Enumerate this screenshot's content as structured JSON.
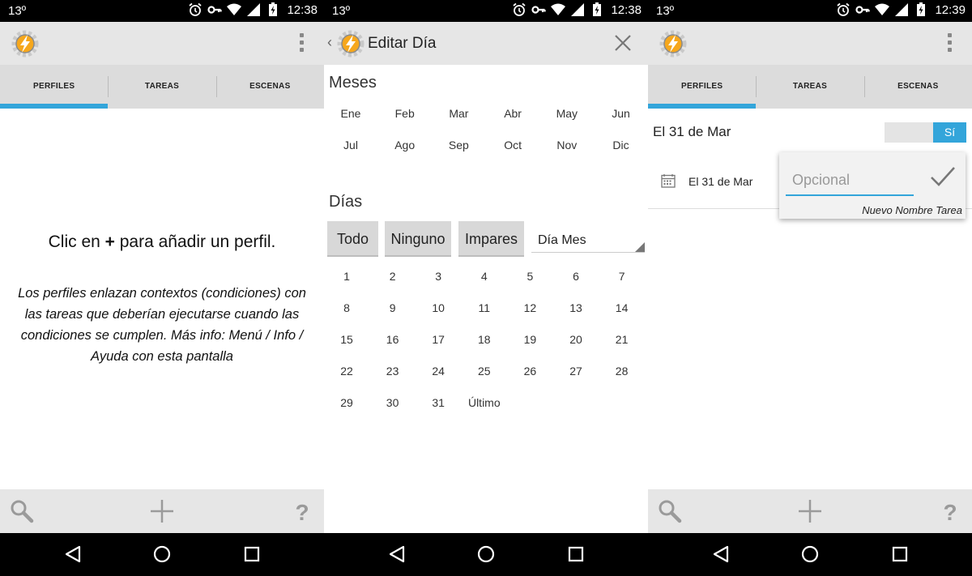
{
  "screens": [
    {
      "status": {
        "temp": "13º",
        "time": "12:38"
      },
      "tabs": [
        "PERFILES",
        "TAREAS",
        "ESCENAS"
      ],
      "empty_title_pre": "Clic en ",
      "empty_title_plus": "+",
      "empty_title_post": " para añadir un perfil.",
      "empty_desc": "Los perfiles enlazan contextos (condiciones) con las tareas que deberían ejecutarse cuando las condiciones se cumplen. Más info:  Menú / Info / Ayuda con esta pantalla"
    },
    {
      "status": {
        "temp": "13º",
        "time": "12:38"
      },
      "title": "Editar Día",
      "months_title": "Meses",
      "months": [
        "Ene",
        "Feb",
        "Mar",
        "Abr",
        "May",
        "Jun",
        "Jul",
        "Ago",
        "Sep",
        "Oct",
        "Nov",
        "Dic"
      ],
      "days_title": "Días",
      "buttons": {
        "all": "Todo",
        "none": "Ninguno",
        "odd": "Impares"
      },
      "select_value": "Día Mes",
      "days": [
        "1",
        "2",
        "3",
        "4",
        "5",
        "6",
        "7",
        "8",
        "9",
        "10",
        "11",
        "12",
        "13",
        "14",
        "15",
        "16",
        "17",
        "18",
        "19",
        "20",
        "21",
        "22",
        "23",
        "24",
        "25",
        "26",
        "27",
        "28",
        "29",
        "30",
        "31",
        "Último"
      ]
    },
    {
      "status": {
        "temp": "13º",
        "time": "12:39"
      },
      "tabs": [
        "PERFILES",
        "TAREAS",
        "ESCENAS"
      ],
      "profile_name": "El 31 de Mar",
      "toggle_label": "Sí",
      "context_label": "El 31 de Mar",
      "popup": {
        "placeholder": "Opcional",
        "hint": "Nuevo Nombre Tarea"
      }
    }
  ],
  "colors": {
    "accent": "#33a5da",
    "bar": "#e6e6e6",
    "tabs": "#dcdcdc"
  }
}
